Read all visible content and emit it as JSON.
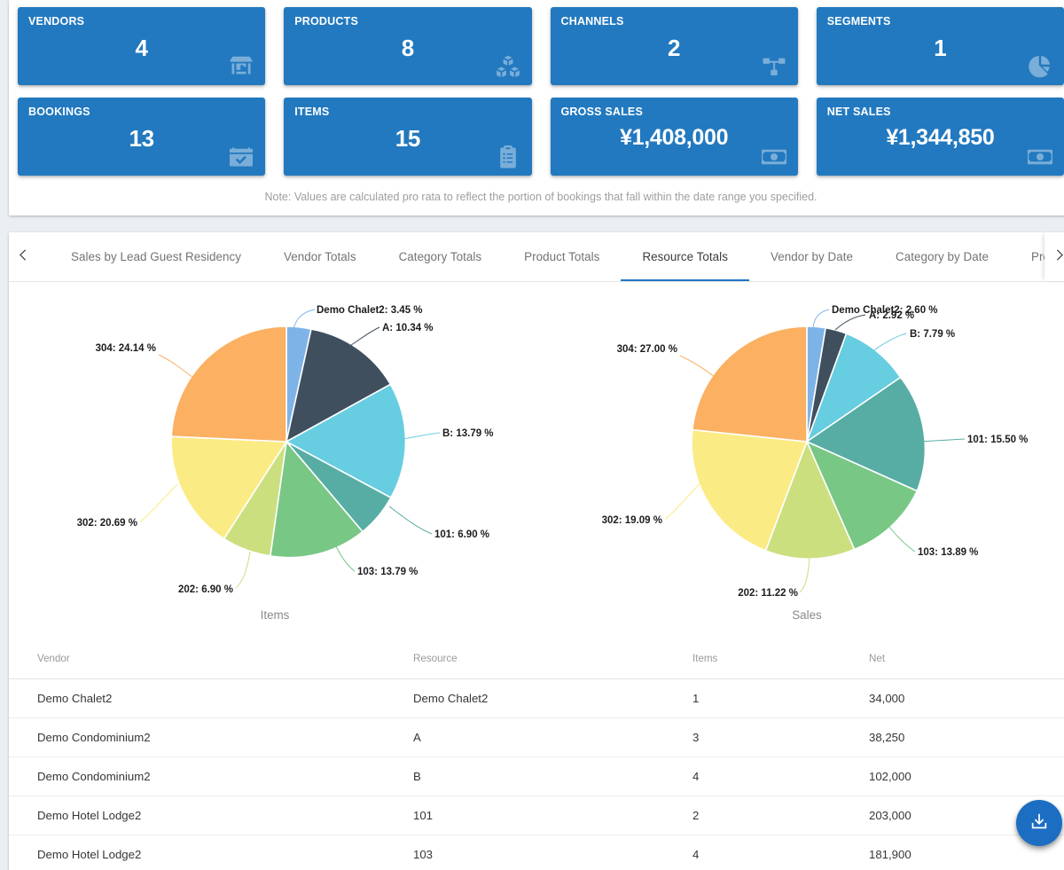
{
  "kpi": {
    "cards": [
      {
        "label": "VENDORS",
        "value": "4",
        "icon": "store-icon"
      },
      {
        "label": "PRODUCTS",
        "value": "8",
        "icon": "cubes-icon"
      },
      {
        "label": "CHANNELS",
        "value": "2",
        "icon": "sitemap-icon"
      },
      {
        "label": "SEGMENTS",
        "value": "1",
        "icon": "pie-chart-icon"
      },
      {
        "label": "BOOKINGS",
        "value": "13",
        "icon": "calendar-check-icon"
      },
      {
        "label": "ITEMS",
        "value": "15",
        "icon": "clipboard-list-icon"
      },
      {
        "label": "GROSS SALES",
        "value": "¥1,408,000",
        "icon": "money-bill-icon"
      },
      {
        "label": "NET SALES",
        "value": "¥1,344,850",
        "icon": "money-bill-icon"
      }
    ],
    "note": "Note: Values are calculated pro rata to reflect the portion of bookings that fall within the date range you specified.",
    "card_color": "#2279bf"
  },
  "tabs": {
    "prev_arrow": "chevron-left-icon",
    "next_arrow": "chevron-right-icon",
    "items": [
      {
        "label": "Sales by Lead Guest Residency",
        "active": false
      },
      {
        "label": "Vendor Totals",
        "active": false
      },
      {
        "label": "Category Totals",
        "active": false
      },
      {
        "label": "Product Totals",
        "active": false
      },
      {
        "label": "Resource Totals",
        "active": true
      },
      {
        "label": "Vendor by Date",
        "active": false
      },
      {
        "label": "Category by Date",
        "active": false
      },
      {
        "label": "Product by Date",
        "active": false
      }
    ],
    "active_indicator_color": "#1e76c4"
  },
  "chart_data": [
    {
      "type": "pie",
      "title": "Items",
      "categories": [
        "Demo Chalet2",
        "A",
        "B",
        "101",
        "103",
        "202",
        "302",
        "304"
      ],
      "values": [
        3.45,
        10.34,
        13.79,
        6.9,
        13.79,
        6.9,
        20.69,
        24.14
      ],
      "labels": [
        "Demo Chalet2: 3.45 %",
        "A: 10.34 %",
        "B: 13.79 %",
        "101: 6.90 %",
        "103: 13.79 %",
        "202: 6.90 %",
        "302: 20.69 %",
        "304: 24.14 %"
      ],
      "colors": [
        "#7eb3e8",
        "#3f4f5e",
        "#67cde0",
        "#57ada4",
        "#79c785",
        "#cbdf7f",
        "#fbeb84",
        "#fbb062"
      ],
      "unit": "%",
      "legend": "none"
    },
    {
      "type": "pie",
      "title": "Sales",
      "categories": [
        "Demo Chalet2",
        "A",
        "B",
        "101",
        "103",
        "202",
        "302",
        "304"
      ],
      "values": [
        2.6,
        2.92,
        7.79,
        15.5,
        13.89,
        11.22,
        19.09,
        27.0
      ],
      "labels": [
        "Demo Chalet2: 2.60 %",
        "A: 2.92 %",
        "B: 7.79 %",
        "101: 15.50 %",
        "103: 13.89 %",
        "202: 11.22 %",
        "302: 19.09 %",
        "304: 27.00 %"
      ],
      "colors": [
        "#7eb3e8",
        "#3f4f5e",
        "#67cde0",
        "#57ada4",
        "#79c785",
        "#cbdf7f",
        "#fbeb84",
        "#fbb062"
      ],
      "unit": "%",
      "legend": "none"
    }
  ],
  "table": {
    "columns": [
      "Vendor",
      "Resource",
      "Items",
      "Net"
    ],
    "rows": [
      {
        "vendor": "Demo Chalet2",
        "resource": "Demo Chalet2",
        "items": "1",
        "net": "34,000"
      },
      {
        "vendor": "Demo Condominium2",
        "resource": "A",
        "items": "3",
        "net": "38,250"
      },
      {
        "vendor": "Demo Condominium2",
        "resource": "B",
        "items": "4",
        "net": "102,000"
      },
      {
        "vendor": "Demo Hotel Lodge2",
        "resource": "101",
        "items": "2",
        "net": "203,000"
      },
      {
        "vendor": "Demo Hotel Lodge2",
        "resource": "103",
        "items": "4",
        "net": "181,900"
      }
    ]
  },
  "fab": {
    "icon": "download-icon",
    "color": "#1b6ec2"
  }
}
